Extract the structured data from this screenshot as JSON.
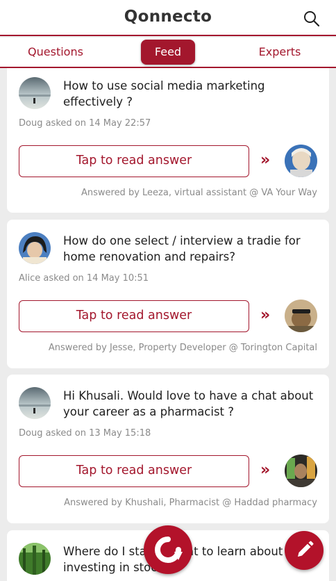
{
  "app": {
    "title": "Qonnecto"
  },
  "icons": {
    "search": "search-icon",
    "refresh": "refresh-icon",
    "compose": "pencil-icon"
  },
  "colors": {
    "accent": "#a3172d",
    "fab": "#b3122a"
  },
  "tabs": [
    {
      "label": "Questions",
      "active": false
    },
    {
      "label": "Feed",
      "active": true
    },
    {
      "label": "Experts",
      "active": false
    }
  ],
  "feed": [
    {
      "question": "How to use social media marketing effectively ?",
      "asked": "Doug asked on 14 May 22:57",
      "button": "Tap to read answer",
      "chevron": "»",
      "answered_by": "Answered by Leeza, virtual assistant @ VA Your Way"
    },
    {
      "question": "How do one select / interview a tradie for home renovation and repairs?",
      "asked": "Alice asked on 14 May 10:51",
      "button": "Tap to read answer",
      "chevron": "»",
      "answered_by": "Answered by Jesse, Property Developer @ Torington Capital"
    },
    {
      "question": "Hi Khusali. Would love to have a chat about your career as a pharmacist ?",
      "asked": "Doug asked on 13 May 15:18",
      "button": "Tap to read answer",
      "chevron": "»",
      "answered_by": "Answered by Khushali, Pharmacist @ Haddad pharmacy"
    },
    {
      "question": "Where do I start... what to learn about investing in stocks"
    }
  ]
}
